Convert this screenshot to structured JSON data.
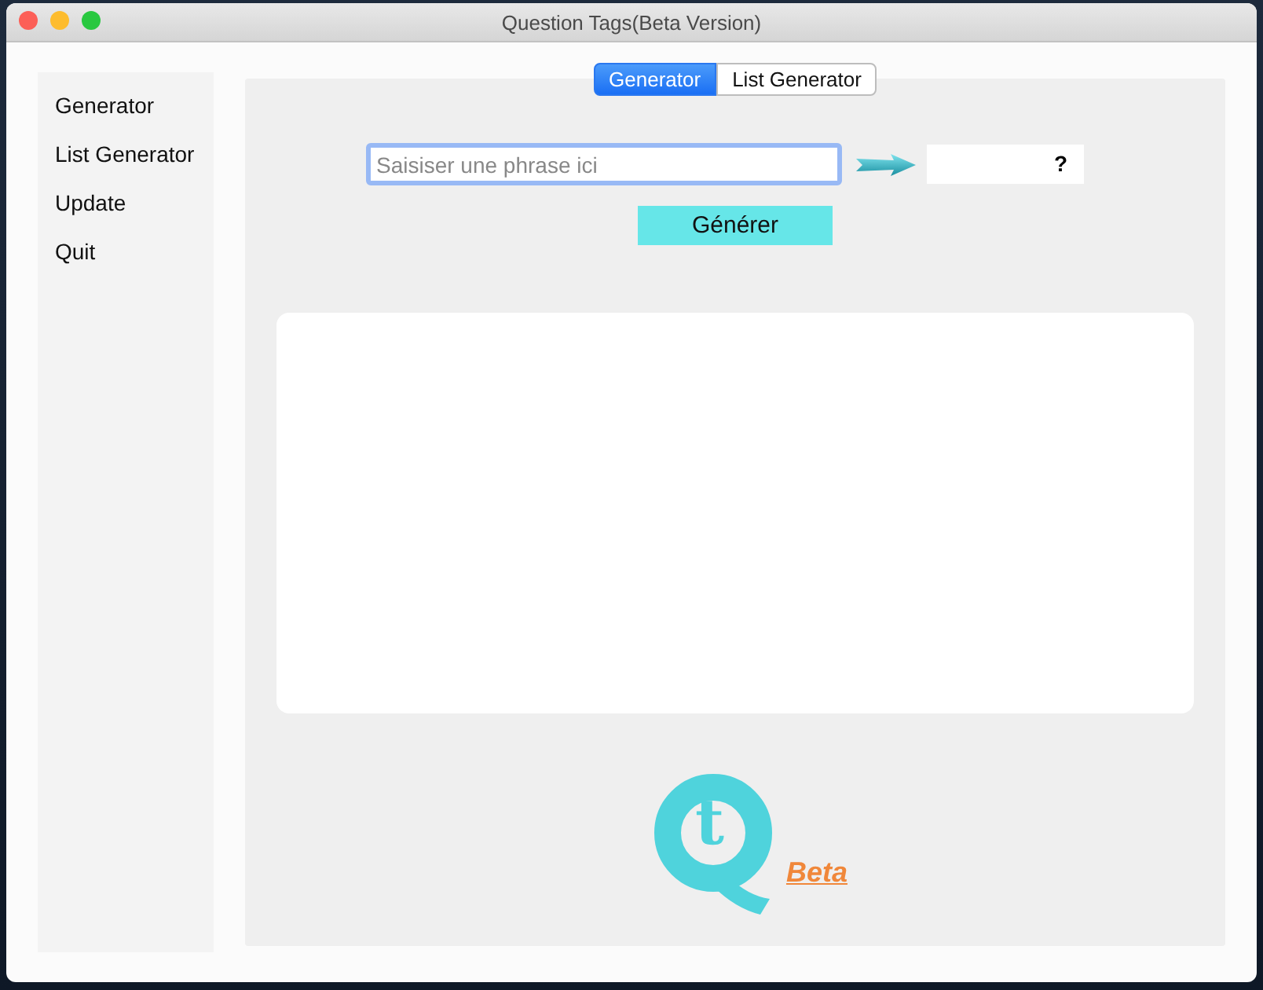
{
  "window": {
    "title": "Question Tags(Beta Version)"
  },
  "sidebar": {
    "items": [
      {
        "label": "Generator"
      },
      {
        "label": "List Generator"
      },
      {
        "label": "Update"
      },
      {
        "label": "Quit"
      }
    ]
  },
  "tabs": [
    {
      "label": "Generator",
      "selected": true
    },
    {
      "label": "List Generator",
      "selected": false
    }
  ],
  "input": {
    "placeholder": "Saisiser une phrase ici"
  },
  "result": {
    "value": "?"
  },
  "generate_button": {
    "label": "Générer"
  },
  "logo": {
    "letter": "t",
    "badge": "Beta"
  }
}
